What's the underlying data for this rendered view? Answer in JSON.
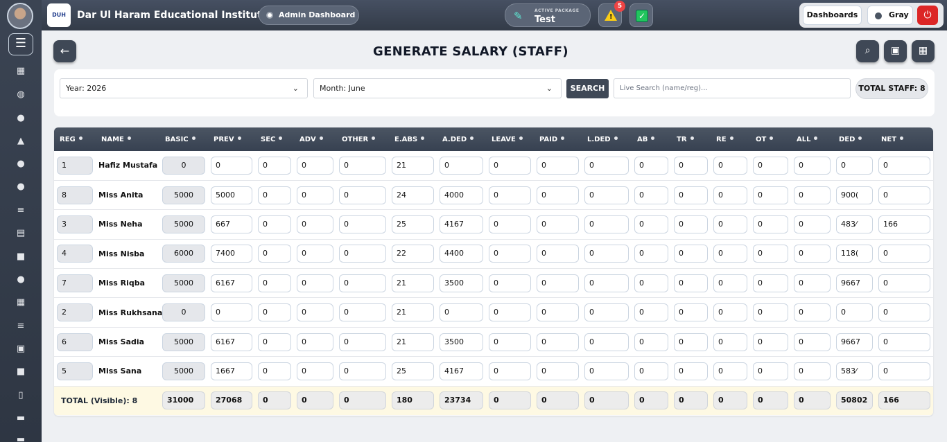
{
  "topbar": {
    "institute_name": "Dar Ul Haram Educational Institute",
    "logo_text": "DUH",
    "admin_label": "Admin Dashboard",
    "package_label": "ACTIVE PACKAGE",
    "package_value": "Test",
    "alert_count": "5",
    "dashboards_label": "Dashboards",
    "theme_label": "Gray"
  },
  "page": {
    "title": "GENERATE SALARY (STAFF)"
  },
  "filters": {
    "year": "Year: 2026",
    "month": "Month: June",
    "search_label": "SEARCH",
    "live_search_placeholder": "Live Search (name/reg)...",
    "total_staff": "TOTAL STAFF: 8"
  },
  "table": {
    "columns": [
      "REG",
      "NAME",
      "BASIC",
      "PREV",
      "SEC",
      "ADV",
      "OTHER",
      "E.ABS",
      "A.DED",
      "LEAVE",
      "PAID",
      "L.DED",
      "AB",
      "TR",
      "RE",
      "OT",
      "ALL",
      "DED",
      "NET"
    ],
    "rows": [
      [
        "1",
        "Hafiz Mustafa",
        "0",
        "0",
        "0",
        "0",
        "0",
        "21",
        "0",
        "0",
        "0",
        "0",
        "0",
        "0",
        "0",
        "0",
        "0",
        "0",
        "0"
      ],
      [
        "8",
        "Miss Anita",
        "5000",
        "5000",
        "0",
        "0",
        "0",
        "24",
        "4000",
        "0",
        "0",
        "0",
        "0",
        "0",
        "0",
        "0",
        "0",
        "900(",
        "0"
      ],
      [
        "3",
        "Miss Neha",
        "5000",
        "667",
        "0",
        "0",
        "0",
        "25",
        "4167",
        "0",
        "0",
        "0",
        "0",
        "0",
        "0",
        "0",
        "0",
        "483⁄",
        "166"
      ],
      [
        "4",
        "Miss Nisba",
        "6000",
        "7400",
        "0",
        "0",
        "0",
        "22",
        "4400",
        "0",
        "0",
        "0",
        "0",
        "0",
        "0",
        "0",
        "0",
        "118(",
        "0"
      ],
      [
        "7",
        "Miss Riqba",
        "5000",
        "6167",
        "0",
        "0",
        "0",
        "21",
        "3500",
        "0",
        "0",
        "0",
        "0",
        "0",
        "0",
        "0",
        "0",
        "9667",
        "0"
      ],
      [
        "2",
        "Miss Rukhsana",
        "0",
        "0",
        "0",
        "0",
        "0",
        "21",
        "0",
        "0",
        "0",
        "0",
        "0",
        "0",
        "0",
        "0",
        "0",
        "0",
        "0"
      ],
      [
        "6",
        "Miss Sadia",
        "5000",
        "6167",
        "0",
        "0",
        "0",
        "21",
        "3500",
        "0",
        "0",
        "0",
        "0",
        "0",
        "0",
        "0",
        "0",
        "9667",
        "0"
      ],
      [
        "5",
        "Miss Sana",
        "5000",
        "1667",
        "0",
        "0",
        "0",
        "25",
        "4167",
        "0",
        "0",
        "0",
        "0",
        "0",
        "0",
        "0",
        "0",
        "583⁄",
        "0"
      ]
    ],
    "totals_label": "TOTAL (Visible): 8",
    "totals": [
      "31000",
      "27068",
      "0",
      "0",
      "0",
      "180",
      "23734",
      "0",
      "0",
      "0",
      "0",
      "0",
      "0",
      "0",
      "0",
      "50802",
      "166"
    ]
  },
  "colors": {
    "accent": "#3f4856",
    "danger": "#dc2626",
    "success": "#22c55e",
    "warning": "#facc15",
    "footer_bg": "#fef9e3"
  }
}
